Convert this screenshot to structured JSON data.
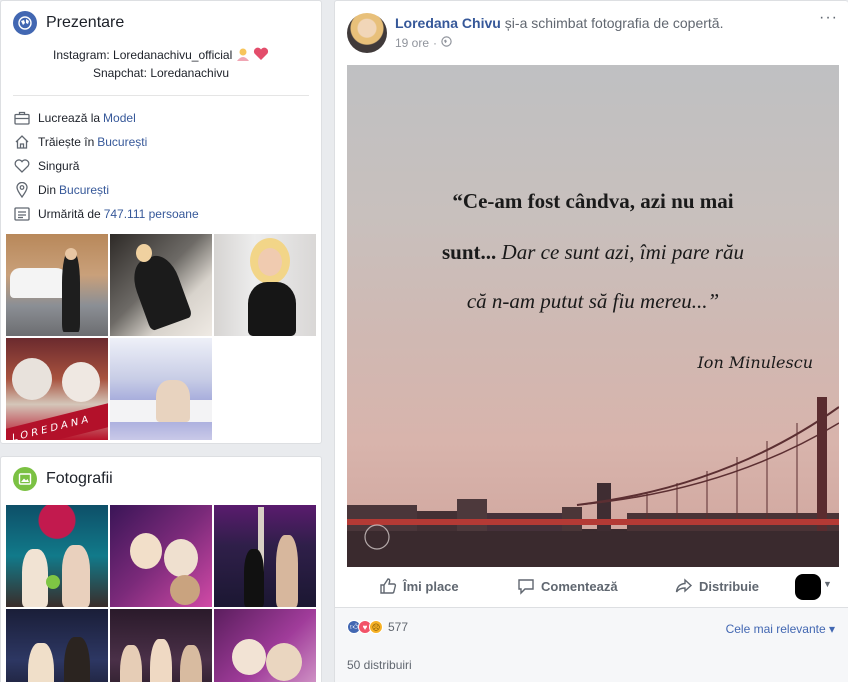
{
  "intro": {
    "title": "Prezentare",
    "bio_line1": "Instagram: Loredanachivu_official",
    "bio_line2": "Snapchat: Loredanachivu",
    "works_prefix": "Lucrează la",
    "works_link": "Model",
    "lives_prefix": "Trăiește în",
    "lives_link": "București",
    "relationship": "Singură",
    "from_prefix": "Din",
    "from_link": "București",
    "followed_prefix": "Urmărită de",
    "followed_link": "747.111 persoane",
    "photo_tiles": [
      {
        "alt": "car"
      },
      {
        "alt": "car-interior"
      },
      {
        "alt": "portrait"
      },
      {
        "alt": "party-bear"
      },
      {
        "alt": "white-room"
      }
    ]
  },
  "photos": {
    "title": "Fotografii"
  },
  "post": {
    "author": "Loredana Chivu",
    "action_text": "și-a schimbat fotografia de copertă.",
    "time": "19 ore",
    "more": "···",
    "cover": {
      "line1": "“Ce-am fost cândva, azi nu mai",
      "line2_bold": "sunt...",
      "line2_italic": "Dar ce sunt azi, îmi pare rău",
      "line3": "că n-am putut să fiu mereu...”",
      "signature": "Ion Minulescu"
    },
    "like_label": "Îmi place",
    "comment_label": "Comentează",
    "share_label": "Distribuie",
    "reaction_count": "577",
    "sort_label": "Cele mai relevante",
    "shares_label": "50 distribuiri"
  },
  "colors": {
    "facebook_blue": "#4267b2",
    "link_blue": "#365899",
    "love_red": "#f25268",
    "haha_yellow": "#f7b125",
    "photos_green": "#7bc143"
  }
}
